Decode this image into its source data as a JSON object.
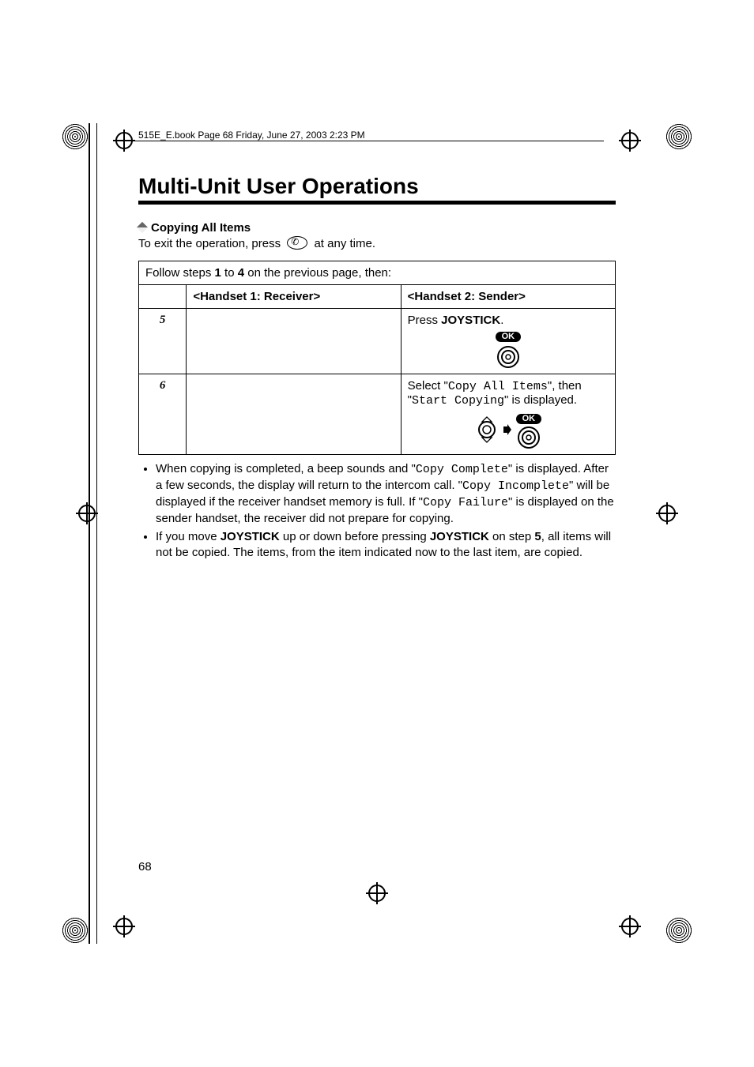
{
  "book_header": "515E_E.book  Page 68  Friday, June 27, 2003  2:23 PM",
  "page_title": "Multi-Unit User Operations",
  "section_heading": "Copying All Items",
  "exit_line_pre": "To exit the operation, press ",
  "exit_line_post": " at any time.",
  "follow_steps_pre": "Follow steps ",
  "follow_steps_b1": "1",
  "follow_steps_mid": " to ",
  "follow_steps_b2": "4",
  "follow_steps_post": " on the previous page, then:",
  "header_receiver": "<Handset 1: Receiver>",
  "header_sender": "<Handset 2: Sender>",
  "step5_num": "5",
  "step5_sender_pre": "Press ",
  "step5_sender_bold": "JOYSTICK",
  "step5_sender_post": ".",
  "step6_num": "6",
  "step6_sender_pre": "Select \"",
  "step6_sender_m1": "Copy All Items",
  "step6_sender_mid": "\", then \"",
  "step6_sender_m2": "Start Copying",
  "step6_sender_post": "\" is displayed.",
  "ok_label": "OK",
  "bullet1_a": "When copying is completed, a beep sounds and \"",
  "bullet1_m1": "Copy Complete",
  "bullet1_b": "\" is displayed. After a few seconds, the display will return to the intercom call. \"",
  "bullet1_m2": "Copy Incomplete",
  "bullet1_c": "\" will be displayed if the receiver handset memory is full. If \"",
  "bullet1_m3": "Copy Failure",
  "bullet1_d": "\" is displayed on the sender handset, the receiver did not prepare for copying.",
  "bullet2_a": "If you move ",
  "bullet2_b1": "JOYSTICK",
  "bullet2_b": " up or down before pressing ",
  "bullet2_b2": "JOYSTICK",
  "bullet2_c": " on step ",
  "bullet2_b3": "5",
  "bullet2_d": ", all items will not be copied. The items, from the item indicated now to the last item, are copied.",
  "page_number": "68"
}
